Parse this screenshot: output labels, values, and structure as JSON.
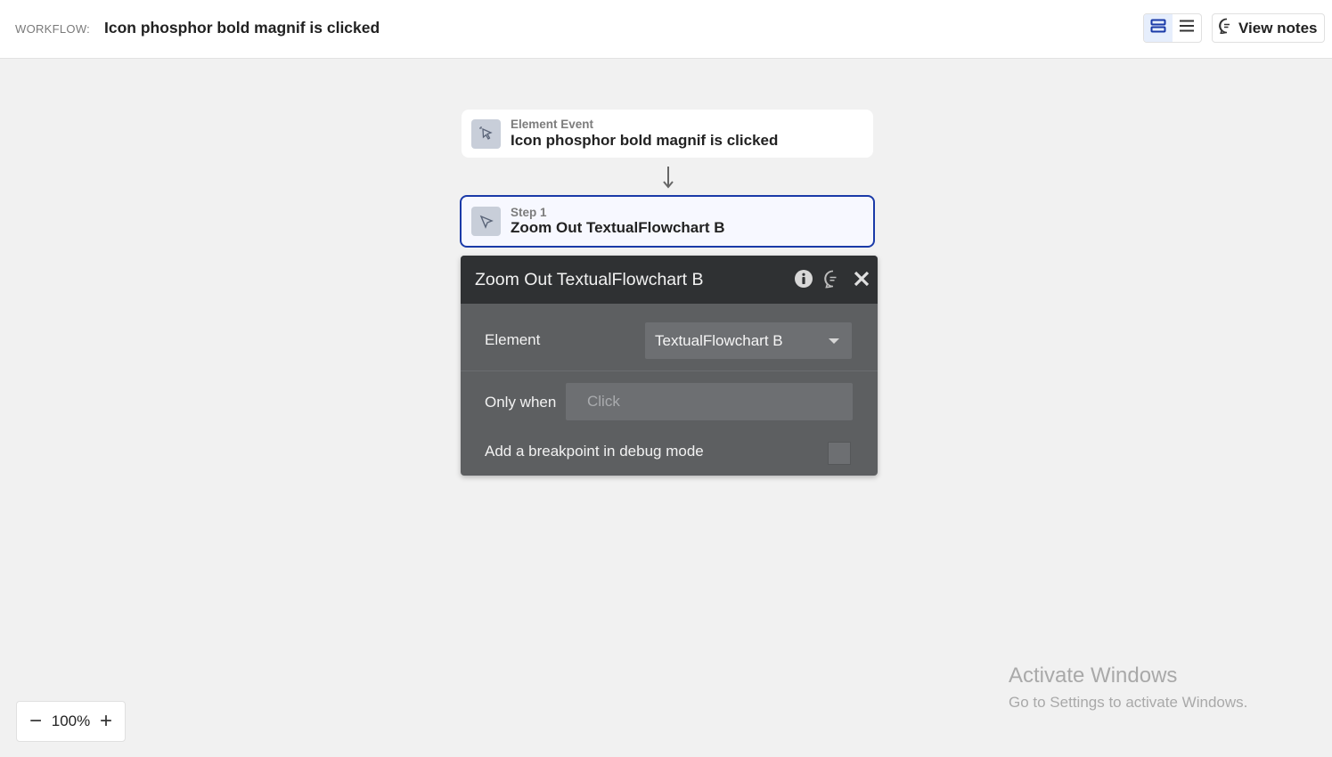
{
  "header": {
    "label": "WORKFLOW:",
    "title": "Icon phosphor bold magnif is clicked",
    "view_notes_label": "View notes",
    "icons": [
      "stacked-view-icon",
      "list-view-icon",
      "comment-icon"
    ]
  },
  "event_card": {
    "subtitle": "Element Event",
    "title": "Icon phosphor bold magnif is clicked",
    "icon": "cursor-click-icon"
  },
  "step_card": {
    "subtitle": "Step 1",
    "title": "Zoom Out TextualFlowchart B",
    "icon": "cursor-arrow-icon"
  },
  "panel": {
    "title": "Zoom Out TextualFlowchart B",
    "icons": [
      "info-icon",
      "comment-icon",
      "close-icon"
    ],
    "element_label": "Element",
    "element_value": "TextualFlowchart B",
    "only_when_label": "Only when",
    "only_when_placeholder": "Click",
    "breakpoint_label": "Add a breakpoint in debug mode",
    "breakpoint_checked": false
  },
  "zoom": {
    "minus": "−",
    "value": "100%",
    "plus": "+"
  },
  "watermark": {
    "line1": "Activate Windows",
    "line2": "Go to Settings to activate Windows."
  },
  "colors": {
    "accent": "#1a3aa8",
    "panel_bg": "#5d5f61",
    "panel_head_bg": "#2f3133",
    "canvas_bg": "#f1f1f1"
  }
}
